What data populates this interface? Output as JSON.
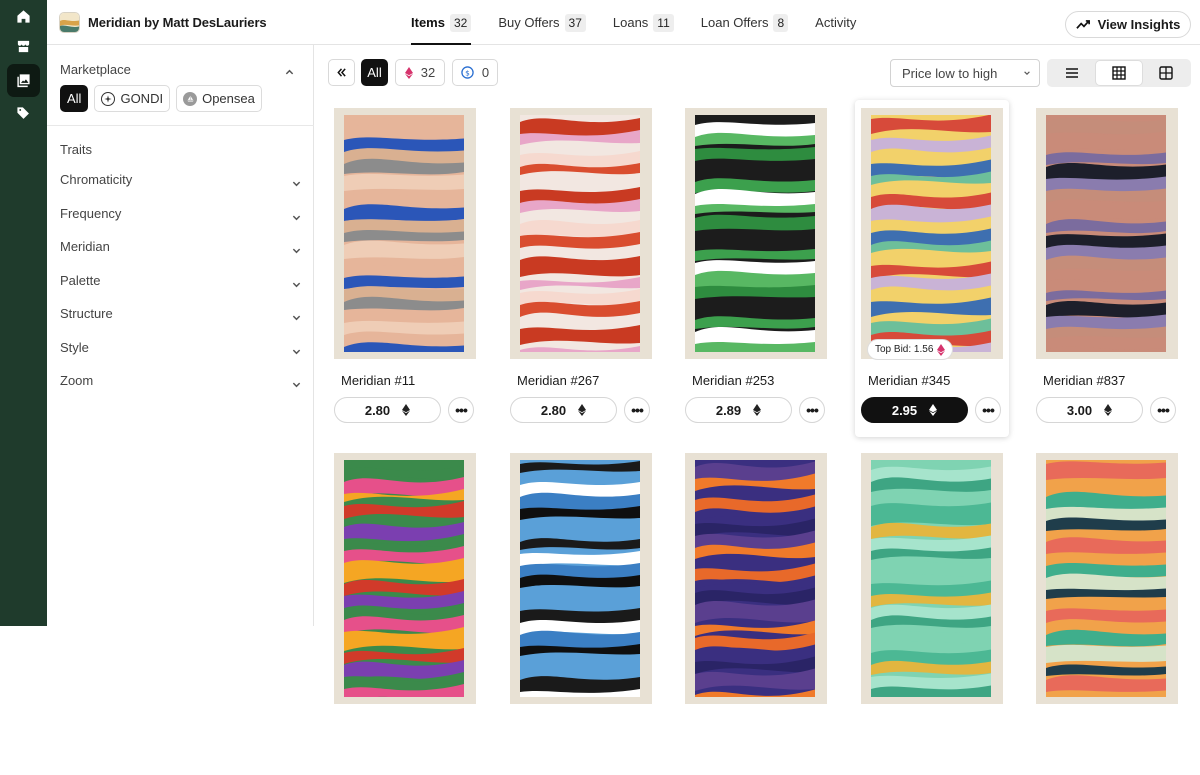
{
  "collection": {
    "name": "Meridian by Matt DesLauriers"
  },
  "tabs": [
    {
      "label": "Items",
      "count": "32"
    },
    {
      "label": "Buy Offers",
      "count": "37"
    },
    {
      "label": "Loans",
      "count": "11"
    },
    {
      "label": "Loan Offers",
      "count": "8"
    },
    {
      "label": "Activity",
      "count": ""
    }
  ],
  "insights": {
    "label": "View Insights"
  },
  "sidebar": {
    "marketplace_title": "Marketplace",
    "marketplaces": [
      "All",
      "GONDI",
      "Opensea"
    ],
    "traits_title": "Traits",
    "traits": [
      "Chromaticity",
      "Frequency",
      "Meridian",
      "Palette",
      "Structure",
      "Style",
      "Zoom"
    ]
  },
  "filters": {
    "all": "All",
    "count_a": "32",
    "count_b": "0"
  },
  "sort": {
    "selected": "Price low to high"
  },
  "cards": [
    {
      "name": "Meridian #11",
      "price": "2.80",
      "palette": [
        "#e6b59a",
        "#2b56b8",
        "#d9b091",
        "#8c8c8c",
        "#efcdb6"
      ]
    },
    {
      "name": "Meridian #267",
      "price": "2.80",
      "palette": [
        "#f2e7e1",
        "#c93a22",
        "#e8a6c8",
        "#f6d9cf",
        "#d94d2f"
      ]
    },
    {
      "name": "Meridian #253",
      "price": "2.89",
      "palette": [
        "#1c1c1c",
        "#3ca04d",
        "#ffffff",
        "#58b863",
        "#2e8c3f"
      ]
    },
    {
      "name": "Meridian #345",
      "price": "2.95",
      "top_bid": "Top Bid: 1.56",
      "palette": [
        "#f2d16a",
        "#3e6fb0",
        "#6dbf9a",
        "#d74a3a",
        "#c9b3d6"
      ]
    },
    {
      "name": "Meridian #837",
      "price": "3.00",
      "palette": [
        "#c98b79",
        "#7b6c9e",
        "#1d1f2b",
        "#8a7cae",
        "#c58d7a"
      ]
    },
    {
      "name": "",
      "price": "",
      "palette": [
        "#3b8a4b",
        "#e6508a",
        "#f5a623",
        "#d13a2a",
        "#7b3fb0"
      ]
    },
    {
      "name": "",
      "price": "",
      "palette": [
        "#5aa0d8",
        "#1a1a1a",
        "#ffffff",
        "#3b7fc4",
        "#0f0f0f"
      ]
    },
    {
      "name": "",
      "price": "",
      "palette": [
        "#3a2f80",
        "#2a2466",
        "#5a3f8e",
        "#f07a2a",
        "#e8692a"
      ]
    },
    {
      "name": "",
      "price": "",
      "palette": [
        "#7fd3b2",
        "#4cb894",
        "#e2b640",
        "#a6e4cc",
        "#3ea583"
      ]
    },
    {
      "name": "",
      "price": "",
      "palette": [
        "#f1a24a",
        "#3fae8c",
        "#d6e3c8",
        "#1f3d4b",
        "#e86a5a"
      ]
    }
  ]
}
